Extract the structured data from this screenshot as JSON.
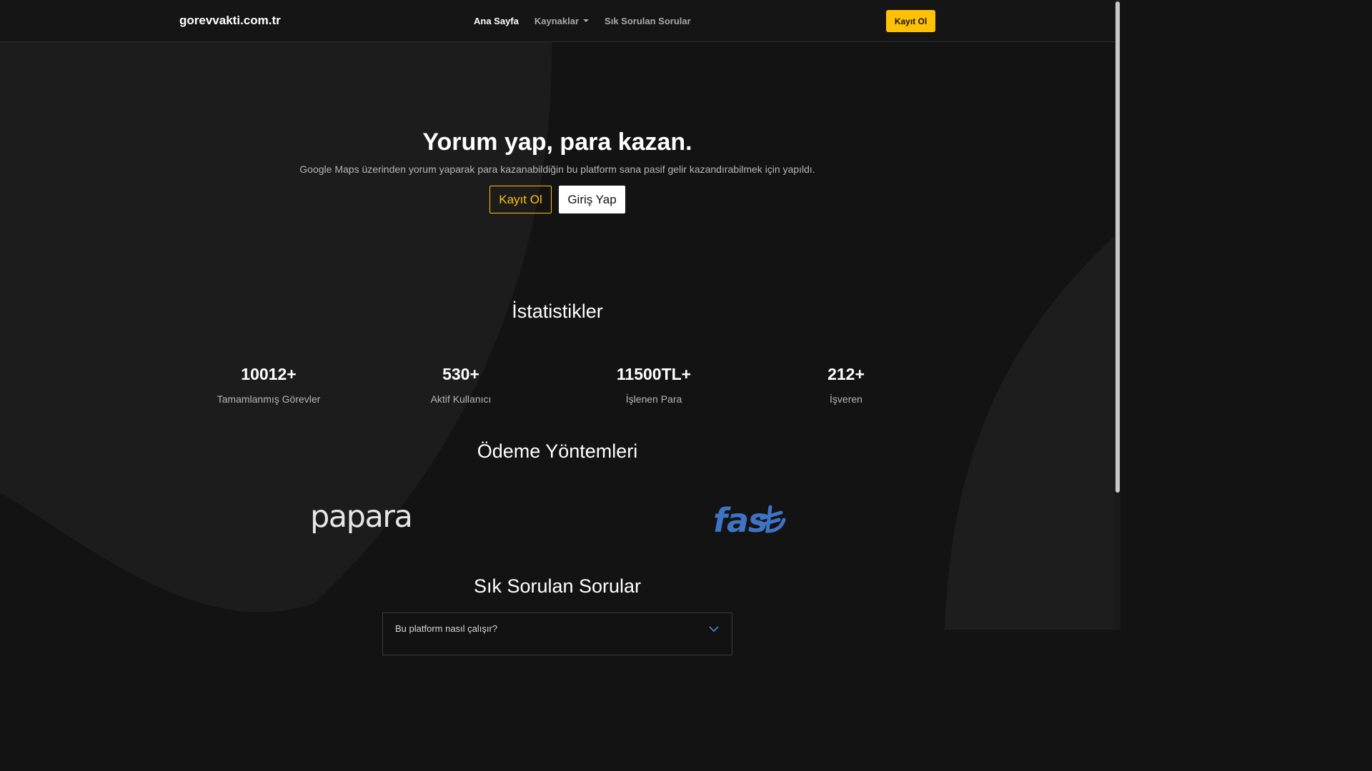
{
  "brand": {
    "name": "gorevvakti.com.tr"
  },
  "nav": {
    "items": [
      {
        "label": "Ana Sayfa",
        "active": true
      },
      {
        "label": "Kaynaklar",
        "dropdown": true
      },
      {
        "label": "Sık Sorulan Sorular"
      }
    ],
    "cta_label": "Kayıt Ol"
  },
  "hero": {
    "title": "Yorum yap, para kazan.",
    "subtitle": "Google Maps üzerinden yorum yaparak para kazanabildiğin bu platform sana pasif gelir kazandırabilmek için yapıldı.",
    "register_label": "Kayıt Ol",
    "login_label": "Giriş Yap"
  },
  "stats": {
    "title": "İstatistikler",
    "items": [
      {
        "value": "10012+",
        "label": "Tamamlanmış Görevler"
      },
      {
        "value": "530+",
        "label": "Aktif Kullanıcı"
      },
      {
        "value": "11500TL+",
        "label": "İşlenen Para"
      },
      {
        "value": "212+",
        "label": "İşveren"
      }
    ]
  },
  "payments": {
    "title": "Ödeme Yöntemleri",
    "methods": [
      {
        "name": "papara",
        "icon": "papara-logo",
        "color": "#e6e6e6"
      },
      {
        "name": "fast",
        "icon": "fast-logo",
        "color": "#3f73c4"
      }
    ]
  },
  "faq": {
    "title": "Sık Sorulan Sorular",
    "items": [
      {
        "question": "Bu platform nasıl çalışır?"
      }
    ]
  },
  "colors": {
    "accent": "#ffc107",
    "background": "#131313",
    "navbar": "#151515"
  }
}
